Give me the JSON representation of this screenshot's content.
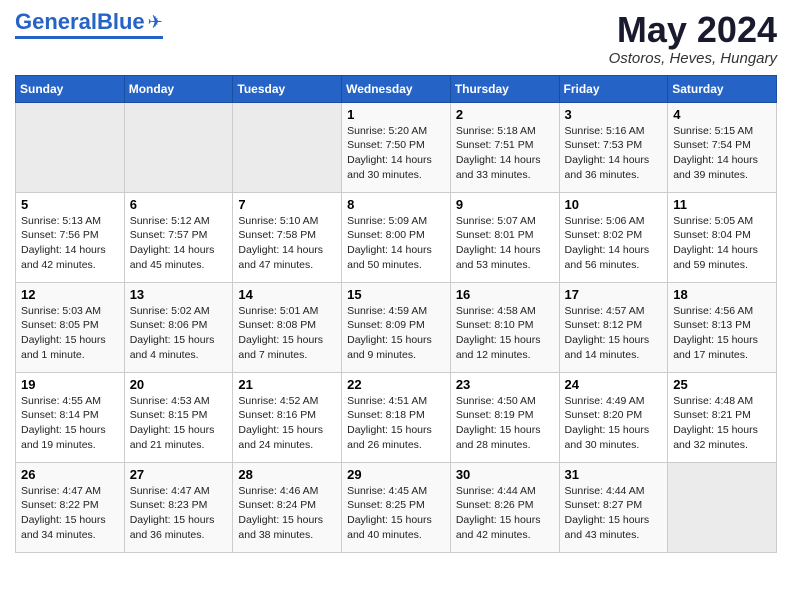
{
  "logo": {
    "general": "General",
    "blue": "Blue"
  },
  "header": {
    "title": "May 2024",
    "location": "Ostoros, Heves, Hungary"
  },
  "weekdays": [
    "Sunday",
    "Monday",
    "Tuesday",
    "Wednesday",
    "Thursday",
    "Friday",
    "Saturday"
  ],
  "weeks": [
    [
      {
        "day": "",
        "info": ""
      },
      {
        "day": "",
        "info": ""
      },
      {
        "day": "",
        "info": ""
      },
      {
        "day": "1",
        "info": "Sunrise: 5:20 AM\nSunset: 7:50 PM\nDaylight: 14 hours\nand 30 minutes."
      },
      {
        "day": "2",
        "info": "Sunrise: 5:18 AM\nSunset: 7:51 PM\nDaylight: 14 hours\nand 33 minutes."
      },
      {
        "day": "3",
        "info": "Sunrise: 5:16 AM\nSunset: 7:53 PM\nDaylight: 14 hours\nand 36 minutes."
      },
      {
        "day": "4",
        "info": "Sunrise: 5:15 AM\nSunset: 7:54 PM\nDaylight: 14 hours\nand 39 minutes."
      }
    ],
    [
      {
        "day": "5",
        "info": "Sunrise: 5:13 AM\nSunset: 7:56 PM\nDaylight: 14 hours\nand 42 minutes."
      },
      {
        "day": "6",
        "info": "Sunrise: 5:12 AM\nSunset: 7:57 PM\nDaylight: 14 hours\nand 45 minutes."
      },
      {
        "day": "7",
        "info": "Sunrise: 5:10 AM\nSunset: 7:58 PM\nDaylight: 14 hours\nand 47 minutes."
      },
      {
        "day": "8",
        "info": "Sunrise: 5:09 AM\nSunset: 8:00 PM\nDaylight: 14 hours\nand 50 minutes."
      },
      {
        "day": "9",
        "info": "Sunrise: 5:07 AM\nSunset: 8:01 PM\nDaylight: 14 hours\nand 53 minutes."
      },
      {
        "day": "10",
        "info": "Sunrise: 5:06 AM\nSunset: 8:02 PM\nDaylight: 14 hours\nand 56 minutes."
      },
      {
        "day": "11",
        "info": "Sunrise: 5:05 AM\nSunset: 8:04 PM\nDaylight: 14 hours\nand 59 minutes."
      }
    ],
    [
      {
        "day": "12",
        "info": "Sunrise: 5:03 AM\nSunset: 8:05 PM\nDaylight: 15 hours\nand 1 minute."
      },
      {
        "day": "13",
        "info": "Sunrise: 5:02 AM\nSunset: 8:06 PM\nDaylight: 15 hours\nand 4 minutes."
      },
      {
        "day": "14",
        "info": "Sunrise: 5:01 AM\nSunset: 8:08 PM\nDaylight: 15 hours\nand 7 minutes."
      },
      {
        "day": "15",
        "info": "Sunrise: 4:59 AM\nSunset: 8:09 PM\nDaylight: 15 hours\nand 9 minutes."
      },
      {
        "day": "16",
        "info": "Sunrise: 4:58 AM\nSunset: 8:10 PM\nDaylight: 15 hours\nand 12 minutes."
      },
      {
        "day": "17",
        "info": "Sunrise: 4:57 AM\nSunset: 8:12 PM\nDaylight: 15 hours\nand 14 minutes."
      },
      {
        "day": "18",
        "info": "Sunrise: 4:56 AM\nSunset: 8:13 PM\nDaylight: 15 hours\nand 17 minutes."
      }
    ],
    [
      {
        "day": "19",
        "info": "Sunrise: 4:55 AM\nSunset: 8:14 PM\nDaylight: 15 hours\nand 19 minutes."
      },
      {
        "day": "20",
        "info": "Sunrise: 4:53 AM\nSunset: 8:15 PM\nDaylight: 15 hours\nand 21 minutes."
      },
      {
        "day": "21",
        "info": "Sunrise: 4:52 AM\nSunset: 8:16 PM\nDaylight: 15 hours\nand 24 minutes."
      },
      {
        "day": "22",
        "info": "Sunrise: 4:51 AM\nSunset: 8:18 PM\nDaylight: 15 hours\nand 26 minutes."
      },
      {
        "day": "23",
        "info": "Sunrise: 4:50 AM\nSunset: 8:19 PM\nDaylight: 15 hours\nand 28 minutes."
      },
      {
        "day": "24",
        "info": "Sunrise: 4:49 AM\nSunset: 8:20 PM\nDaylight: 15 hours\nand 30 minutes."
      },
      {
        "day": "25",
        "info": "Sunrise: 4:48 AM\nSunset: 8:21 PM\nDaylight: 15 hours\nand 32 minutes."
      }
    ],
    [
      {
        "day": "26",
        "info": "Sunrise: 4:47 AM\nSunset: 8:22 PM\nDaylight: 15 hours\nand 34 minutes."
      },
      {
        "day": "27",
        "info": "Sunrise: 4:47 AM\nSunset: 8:23 PM\nDaylight: 15 hours\nand 36 minutes."
      },
      {
        "day": "28",
        "info": "Sunrise: 4:46 AM\nSunset: 8:24 PM\nDaylight: 15 hours\nand 38 minutes."
      },
      {
        "day": "29",
        "info": "Sunrise: 4:45 AM\nSunset: 8:25 PM\nDaylight: 15 hours\nand 40 minutes."
      },
      {
        "day": "30",
        "info": "Sunrise: 4:44 AM\nSunset: 8:26 PM\nDaylight: 15 hours\nand 42 minutes."
      },
      {
        "day": "31",
        "info": "Sunrise: 4:44 AM\nSunset: 8:27 PM\nDaylight: 15 hours\nand 43 minutes."
      },
      {
        "day": "",
        "info": ""
      }
    ]
  ]
}
